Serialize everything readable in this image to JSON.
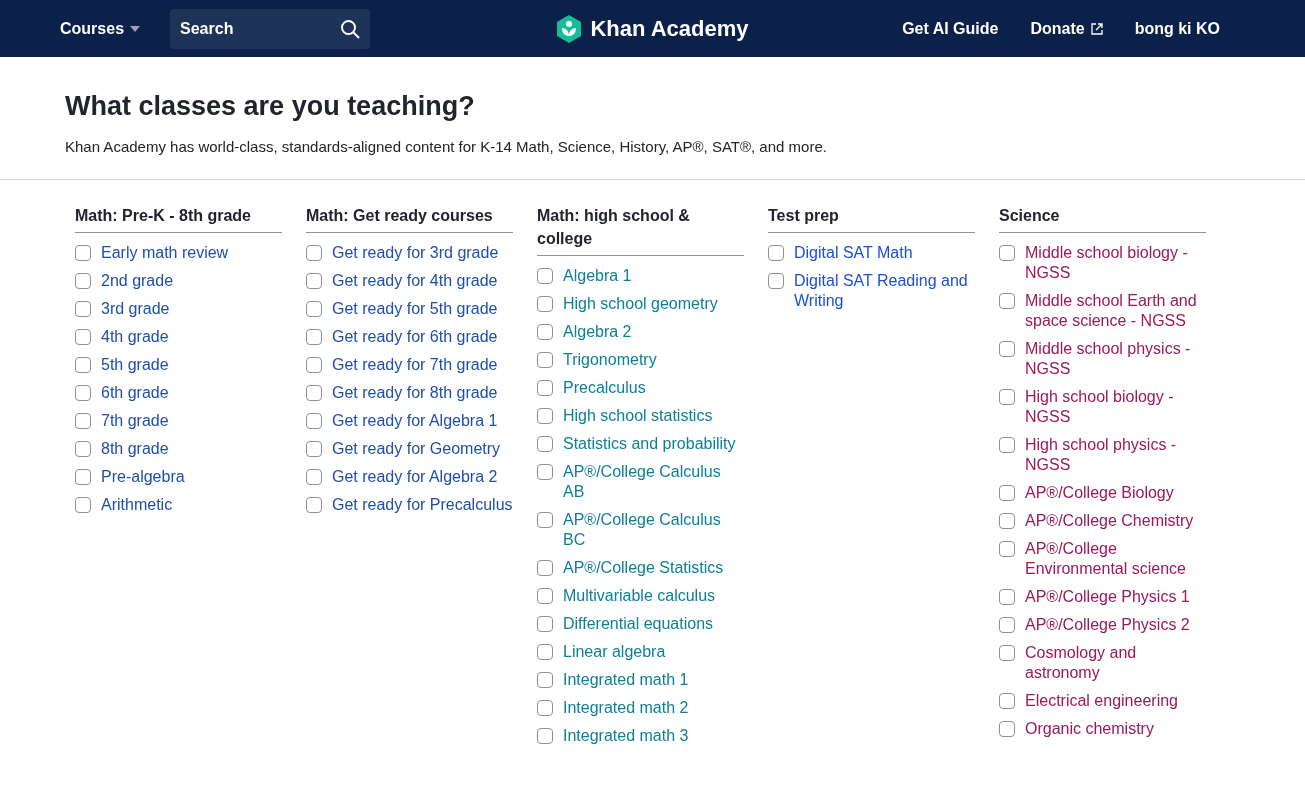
{
  "nav": {
    "menu": "Courses",
    "search": {
      "placeholder": "Search"
    },
    "logo": "Khan Academy",
    "links": [
      "Get AI Guide",
      "Donate"
    ],
    "user": "bong ki KO"
  },
  "heading": "What classes are you teaching?",
  "intro": "Khan Academy has world-class, standards-aligned content for K-14 Math, Science, History, AP®, SAT®, and more.",
  "sections": [
    {
      "title": "Math: Pre-K - 8th grade",
      "color": "#1f4fa8",
      "items": [
        {
          "label": "Early math review",
          "checked": false
        },
        {
          "label": "2nd grade",
          "checked": false
        },
        {
          "label": "3rd grade",
          "checked": false
        },
        {
          "label": "4th grade",
          "checked": false
        },
        {
          "label": "5th grade",
          "checked": false
        },
        {
          "label": "6th grade",
          "checked": false
        },
        {
          "label": "7th grade",
          "checked": false
        },
        {
          "label": "8th grade",
          "checked": false
        },
        {
          "label": "Pre-algebra",
          "checked": false
        },
        {
          "label": "Arithmetic",
          "checked": false
        }
      ]
    },
    {
      "title": "Math: Get ready courses",
      "color": "#1f4fa8",
      "items": [
        {
          "label": "Get ready for 3rd grade",
          "checked": false
        },
        {
          "label": "Get ready for 4th grade",
          "checked": false
        },
        {
          "label": "Get ready for 5th grade",
          "checked": false
        },
        {
          "label": "Get ready for 6th grade",
          "checked": false
        },
        {
          "label": "Get ready for 7th grade",
          "checked": false
        },
        {
          "label": "Get ready for 8th grade",
          "checked": false
        },
        {
          "label": "Get ready for Algebra 1",
          "checked": false
        },
        {
          "label": "Get ready for Geometry",
          "checked": false
        },
        {
          "label": "Get ready for Algebra 2",
          "checked": false
        },
        {
          "label": "Get ready for Precalculus",
          "checked": false
        }
      ]
    },
    {
      "title": "Math: high school & college",
      "color": "#0c7f99",
      "items": [
        {
          "label": "Algebra 1",
          "checked": false
        },
        {
          "label": "High school geometry",
          "checked": false
        },
        {
          "label": "Algebra 2",
          "checked": false
        },
        {
          "label": "Trigonometry",
          "checked": false
        },
        {
          "label": "Precalculus",
          "checked": false
        },
        {
          "label": "High school statistics",
          "checked": false
        },
        {
          "label": "Statistics and probability",
          "checked": false
        },
        {
          "label": "AP®/College Calculus AB",
          "checked": false
        },
        {
          "label": "AP®/College Calculus BC",
          "checked": false
        },
        {
          "label": "AP®/College Statistics",
          "checked": false
        },
        {
          "label": "Multivariable calculus",
          "checked": false
        },
        {
          "label": "Differential equations",
          "checked": false
        },
        {
          "label": "Linear algebra",
          "checked": false
        },
        {
          "label": "Integrated math 1",
          "checked": false
        },
        {
          "label": "Integrated math 2",
          "checked": false
        },
        {
          "label": "Integrated math 3",
          "checked": false
        }
      ]
    },
    {
      "title": "Test prep",
      "color": "#1b50d6",
      "items": [
        {
          "label": "Digital SAT Math",
          "checked": false
        },
        {
          "label": "Digital SAT Reading and Writing",
          "checked": false
        }
      ]
    },
    {
      "title": "Science",
      "color": "#9b1a57",
      "items": [
        {
          "label": "Middle school biology - NGSS",
          "checked": false
        },
        {
          "label": "Middle school Earth and space science - NGSS",
          "checked": false
        },
        {
          "label": "Middle school physics - NGSS",
          "checked": false
        },
        {
          "label": "High school biology - NGSS",
          "checked": false
        },
        {
          "label": "High school physics - NGSS",
          "checked": false
        },
        {
          "label": "AP®/College Biology",
          "checked": false
        },
        {
          "label": "AP®/College Chemistry",
          "checked": false
        },
        {
          "label": "AP®/College Environmental science",
          "checked": false
        },
        {
          "label": "AP®/College Physics 1",
          "checked": false
        },
        {
          "label": "AP®/College Physics 2",
          "checked": false
        },
        {
          "label": "Cosmology and astronomy",
          "checked": false
        },
        {
          "label": "Electrical engineering",
          "checked": false
        },
        {
          "label": "Organic chemistry",
          "checked": false
        }
      ]
    }
  ]
}
